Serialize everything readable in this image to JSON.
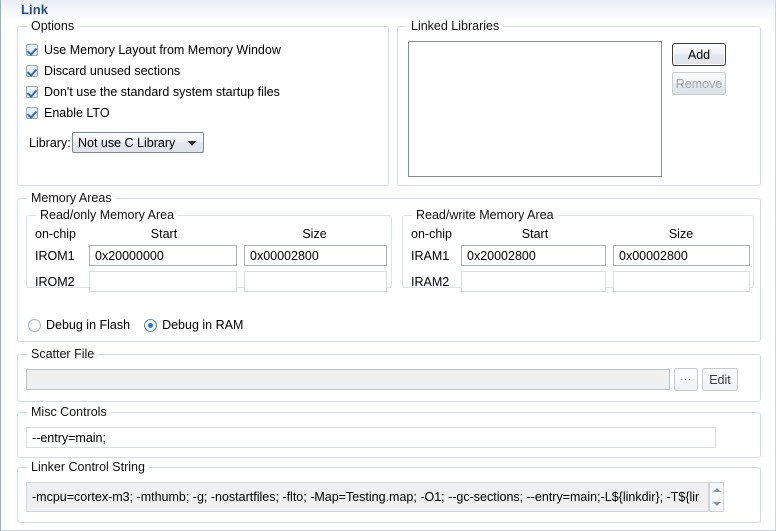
{
  "title": "Link",
  "options": {
    "legend": "Options",
    "checkboxes": [
      {
        "label": "Use Memory Layout from Memory Window",
        "checked": true
      },
      {
        "label": "Discard unused sections",
        "checked": true
      },
      {
        "label": "Don't use the standard system startup files",
        "checked": true
      },
      {
        "label": "Enable LTO",
        "checked": true
      }
    ],
    "library_label": "Library:",
    "library_value": "Not use C Library"
  },
  "linked_libraries": {
    "legend": "Linked Libraries",
    "items": [],
    "add_label": "Add",
    "remove_label": "Remove"
  },
  "memory_areas": {
    "legend": "Memory Areas",
    "read_only": {
      "legend": "Read/only Memory Area",
      "headers": [
        "on-chip",
        "Start",
        "Size"
      ],
      "rows": [
        {
          "name": "IROM1",
          "start": "0x20000000",
          "size": "0x00002800"
        },
        {
          "name": "IROM2",
          "start": "",
          "size": ""
        }
      ]
    },
    "read_write": {
      "legend": "Read/write Memory Area",
      "headers": [
        "on-chip",
        "Start",
        "Size"
      ],
      "rows": [
        {
          "name": "IRAM1",
          "start": "0x20002800",
          "size": "0x00002800"
        },
        {
          "name": "IRAM2",
          "start": "",
          "size": ""
        }
      ]
    },
    "debug_targets": [
      {
        "label": "Debug in Flash",
        "selected": false
      },
      {
        "label": "Debug in RAM",
        "selected": true
      }
    ]
  },
  "scatter_file": {
    "legend": "Scatter File",
    "value": "",
    "browse_label": "...",
    "edit_label": "Edit"
  },
  "misc_controls": {
    "legend": "Misc Controls",
    "value": "--entry=main;"
  },
  "linker_control_string": {
    "legend": "Linker Control String",
    "value": "-mcpu=cortex-m3; -mthumb; -g; -nostartfiles; -flto; -Map=Testing.map; -O1; --gc-sections; --entry=main;-L${linkdir}; -T${lir"
  },
  "colors": {
    "title": "#1f4e8c",
    "accent": "#1a7ad4",
    "group_border": "#d2dce8"
  }
}
